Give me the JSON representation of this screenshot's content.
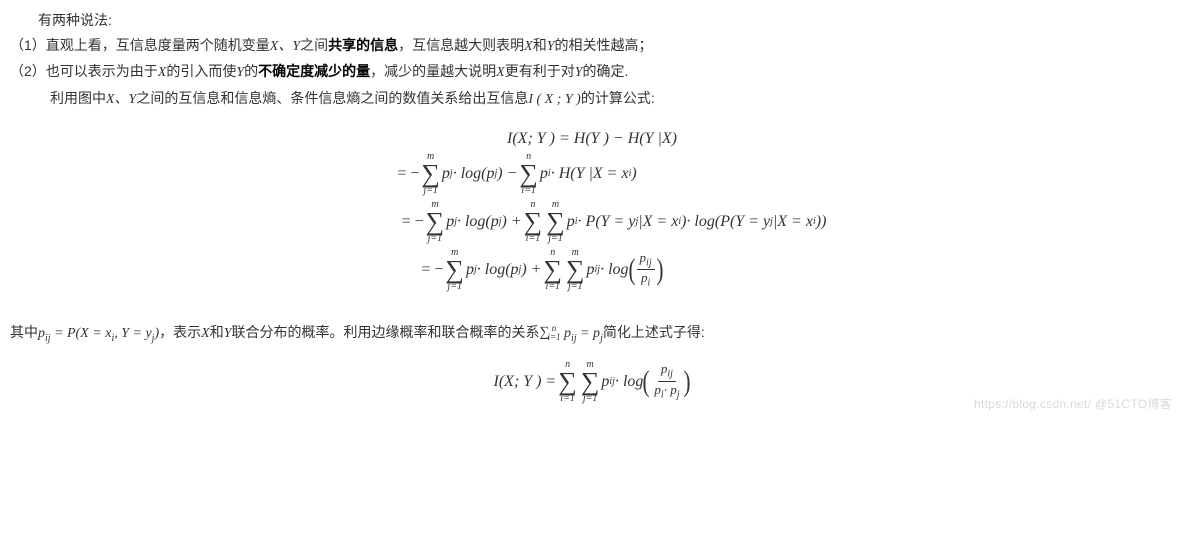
{
  "intro": {
    "lead": "有两种说法:",
    "item1_num": "（1）",
    "item1_a": "直观上看，互信息度量两个随机变量",
    "item1_xy": "X、Y",
    "item1_b": "之间",
    "item1_bold": "共享的信息",
    "item1_c": "，互信息越大则表明",
    "item1_x": "X",
    "item1_d": "和",
    "item1_y": "Y",
    "item1_e": "的相关性越高；",
    "item2_num": "（2）",
    "item2_a": "也可以表示为由于",
    "item2_x": "X",
    "item2_b": "的引入而使",
    "item2_y": "Y",
    "item2_c": "的",
    "item2_bold": "不确定度减少的量",
    "item2_d": "，减少的量越大说明",
    "item2_x2": "X",
    "item2_e": "更有利于对",
    "item2_y2": "Y",
    "item2_f": "的确定.",
    "item3_a": "利用图中",
    "item3_xy": "X、Y",
    "item3_b": "之间的互信息和信息熵、条件信息熵之间的数值关系给出互信息",
    "item3_ixy": "I ( X ; Y )",
    "item3_c": "的计算公式:"
  },
  "eq1": {
    "lhs": "I(X; Y ) = H(Y ) − H(Y |X)"
  },
  "row2": {
    "lead": "= −",
    "s1_top": "m",
    "s1_bot": "j=1",
    "mid1": " p",
    "sub1": "j",
    "mid1b": "· log(p",
    "sub1b": "j",
    "mid1c": ") − ",
    "s2_top": "n",
    "s2_bot": "i=1",
    "mid2": " p",
    "sub2": "i",
    "mid2b": "· H(Y |X = x",
    "sub2b": "i",
    "mid2c": ")"
  },
  "row3": {
    "lead": "= −",
    "s1_top": "m",
    "s1_bot": "j=1",
    "t1a": " p",
    "t1s": "j",
    "t1b": "· log(p",
    "t1s2": "j",
    "t1c": ") + ",
    "s2_top": "n",
    "s2_bot": "i=1",
    "s3_top": "m",
    "s3_bot": "j=1",
    "t2a": " p",
    "t2s": "i",
    "t2b": "· P(Y = y",
    "t2s2": "j",
    "t2c": "|X = x",
    "t2s3": "i",
    "t2d": ")· log(P(Y = y",
    "t2s4": "j",
    "t2e": "|X = x",
    "t2s5": "i",
    "t2f": "))"
  },
  "row4": {
    "lead": "= −",
    "s1_top": "m",
    "s1_bot": "j=1",
    "t1a": " p",
    "t1s": "j",
    "t1b": "· log(p",
    "t1s2": "j",
    "t1c": ") + ",
    "s2_top": "n",
    "s2_bot": "i=1",
    "s3_top": "m",
    "s3_bot": "j=1",
    "t2a": " p",
    "t2s": "ij",
    "t2b": "· log ",
    "frac_num_a": "p",
    "frac_num_s": "ij",
    "frac_den_a": "p",
    "frac_den_s": "i"
  },
  "between": {
    "a": "其中",
    "pij": "p",
    "pij_sub": "ij",
    "eq": " = P(X = x",
    "eq_s1": "i",
    "eq_mid": ", Y = y",
    "eq_s2": "j",
    "eq_end": ")",
    "b": "，表示",
    "x": "X",
    "c": "和",
    "y": "Y",
    "d": "联合分布的概率。利用边缘概率和联合概率的关系",
    "sum_top": "n",
    "sum_bot": "i=1",
    "sum_body_a": " p",
    "sum_body_s": "ij",
    "sum_eq": " = p",
    "sum_eq_s": "j",
    "e": "简化上述式子得:"
  },
  "final": {
    "lhs": "I(X; Y ) = ",
    "s1_top": "n",
    "s1_bot": "i=1",
    "s2_top": "m",
    "s2_bot": "j=1",
    "t_a": " p",
    "t_s": "ij",
    "t_b": "· log ",
    "num_a": "p",
    "num_s": "ij",
    "den_a": "p",
    "den_s1": "i",
    "den_mid": "· p",
    "den_s2": "j"
  },
  "watermark": "https://blog.csdn.net/   @51CTO博客"
}
